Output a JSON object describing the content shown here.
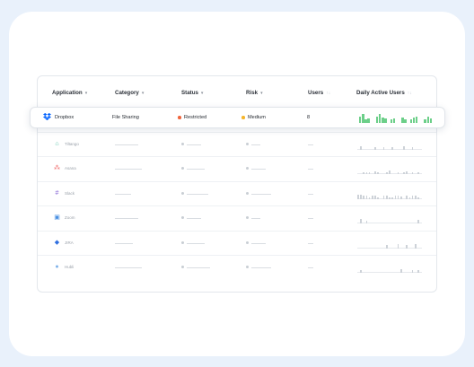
{
  "columns": {
    "application": "Application",
    "category": "Category",
    "status": "Status",
    "risk": "Risk",
    "users": "Users",
    "dau": "Daily Active Users"
  },
  "featured": {
    "app": "Dropbox",
    "category": "File Sharing",
    "status": "Restricted",
    "risk": "Medium",
    "users": "8",
    "status_color": "#f0643c",
    "risk_color": "#f6b52a",
    "spark_color": "#6ccf89",
    "dau": [
      0.7,
      1,
      0.45,
      0.55,
      0,
      0,
      0.75,
      1,
      0.6,
      0.5,
      0,
      0.4,
      0.55,
      0,
      0,
      0.6,
      0.45,
      0,
      0.4,
      0.6,
      0.75,
      0,
      0,
      0.45,
      0.7,
      0.55
    ]
  },
  "rows": [
    {
      "name": "Tiltango",
      "icon": "tiltango-icon",
      "icon_char": "⌂",
      "icon_color": "#56c3a8",
      "dau": [
        0,
        0.6,
        0,
        0,
        0,
        0,
        0.5,
        0,
        0,
        0.4,
        0,
        0,
        0.5,
        0,
        0,
        0,
        0.6,
        0,
        0,
        0.5,
        0,
        0
      ]
    },
    {
      "name": "Asana",
      "icon": "asana-icon",
      "icon_char": "⁂",
      "icon_color": "#f06a6a",
      "dau": [
        0,
        0,
        0.3,
        0.3,
        0.3,
        0,
        0.5,
        0.3,
        0,
        0,
        0.3,
        0.6,
        0,
        0,
        0.4,
        0,
        0.3,
        0.5,
        0,
        0.3,
        0,
        0.3
      ]
    },
    {
      "name": "Slack",
      "icon": "slack-icon",
      "icon_char": "#",
      "icon_color": "#8b6bd6",
      "dau": [
        0.7,
        0.7,
        0.6,
        0.6,
        0.3,
        0.6,
        0.6,
        0.3,
        0,
        0.5,
        0.5,
        0.3,
        0.3,
        0.6,
        0.6,
        0.4,
        0,
        0.5,
        0.3,
        0.5,
        0.6,
        0.3
      ]
    },
    {
      "name": "Zoom",
      "icon": "zoom-icon",
      "icon_char": "▣",
      "icon_color": "#4a90e2",
      "dau": [
        0,
        0.7,
        0,
        0.5,
        0,
        0,
        0,
        0,
        0,
        0,
        0,
        0,
        0,
        0,
        0,
        0,
        0,
        0,
        0,
        0,
        0,
        0.6
      ]
    },
    {
      "name": "JIRA",
      "icon": "jira-icon",
      "icon_char": "◆",
      "icon_color": "#2f6fe0",
      "dau": [
        0,
        0,
        0,
        0,
        0,
        0,
        0,
        0,
        0,
        0,
        0.5,
        0,
        0,
        0,
        0.7,
        0,
        0,
        0.5,
        0,
        0,
        0.6,
        0
      ]
    },
    {
      "name": "Hubli",
      "icon": "hubli-icon",
      "icon_char": "●",
      "icon_color": "#7fb2ea",
      "dau": [
        0,
        0.5,
        0,
        0,
        0,
        0,
        0,
        0,
        0,
        0,
        0,
        0,
        0,
        0,
        0,
        0.6,
        0,
        0,
        0,
        0.5,
        0,
        0.4
      ]
    }
  ]
}
